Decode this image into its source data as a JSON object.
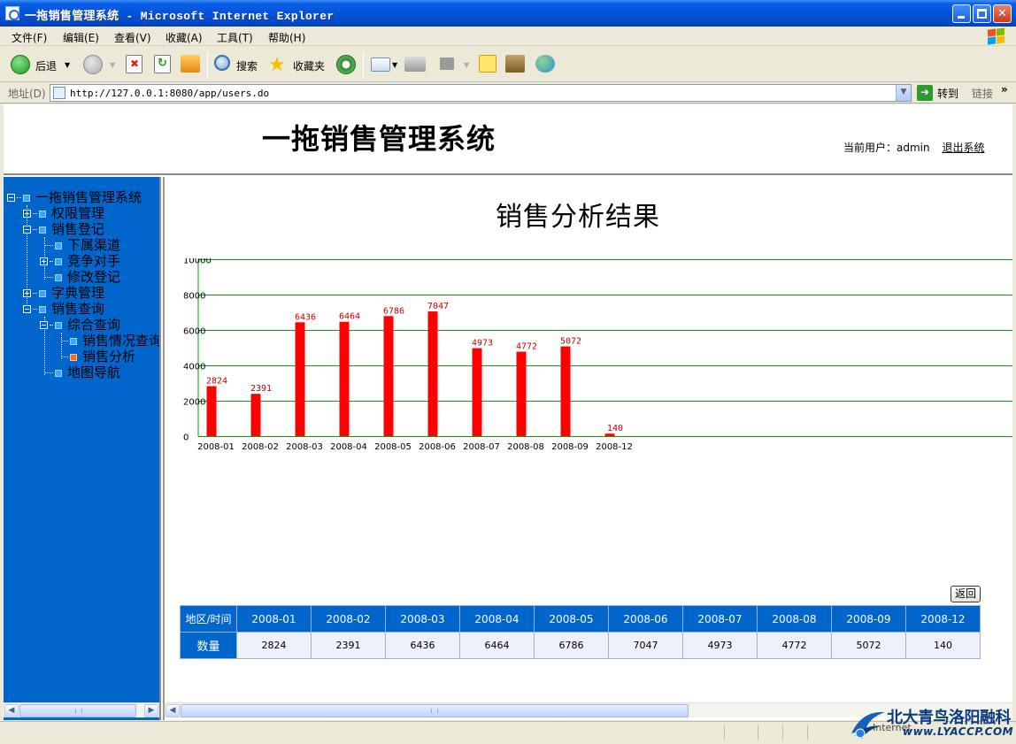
{
  "window": {
    "title": "一拖销售管理系统 - Microsoft Internet Explorer"
  },
  "menu": {
    "items": [
      "文件(F)",
      "编辑(E)",
      "查看(V)",
      "收藏(A)",
      "工具(T)",
      "帮助(H)"
    ]
  },
  "toolbar": {
    "back_label": "后退",
    "search_label": "搜索",
    "favorites_label": "收藏夹"
  },
  "address": {
    "label": "地址(D)",
    "url": "http://127.0.0.1:8080/app/users.do",
    "go_label": "转到",
    "links_label": "链接"
  },
  "header": {
    "site_title": "一拖销售管理系统",
    "user_label": "当前用户：admin",
    "logout_label": "退出系统"
  },
  "tree": {
    "root": "一拖销售管理系统",
    "items": [
      "权限管理",
      "销售登记",
      "下属渠道",
      "竞争对手",
      "修改登记",
      "字典管理",
      "销售查询",
      "综合查询",
      "销售情况查询",
      "销售分析",
      "地图导航"
    ]
  },
  "main": {
    "chart_title": "销售分析结果",
    "back_button": "返回",
    "table_corner": "地区/时间",
    "table_row_label": "数量"
  },
  "chart_data": {
    "type": "bar",
    "title": "销售分析结果",
    "categories": [
      "2008-01",
      "2008-02",
      "2008-03",
      "2008-04",
      "2008-05",
      "2008-06",
      "2008-07",
      "2008-08",
      "2008-09",
      "2008-12"
    ],
    "values": [
      2824,
      2391,
      6436,
      6464,
      6786,
      7047,
      4973,
      4772,
      5072,
      140
    ],
    "y_ticks": [
      "0",
      "2000",
      "4000",
      "6000",
      "8000",
      "10000"
    ],
    "ylim": [
      0,
      10000
    ],
    "grid": true,
    "bar_color": "#ff0000",
    "grid_color": "#00aa00",
    "label_color": "#cc0000"
  },
  "watermark": {
    "name": "北大青鸟洛阳融科",
    "url": "www.LYACCP.COM",
    "zone": "Internet"
  },
  "colors": {
    "sidebar": "#0066cc",
    "table_header": "#0066cc",
    "table_cell": "#eef0fa"
  }
}
